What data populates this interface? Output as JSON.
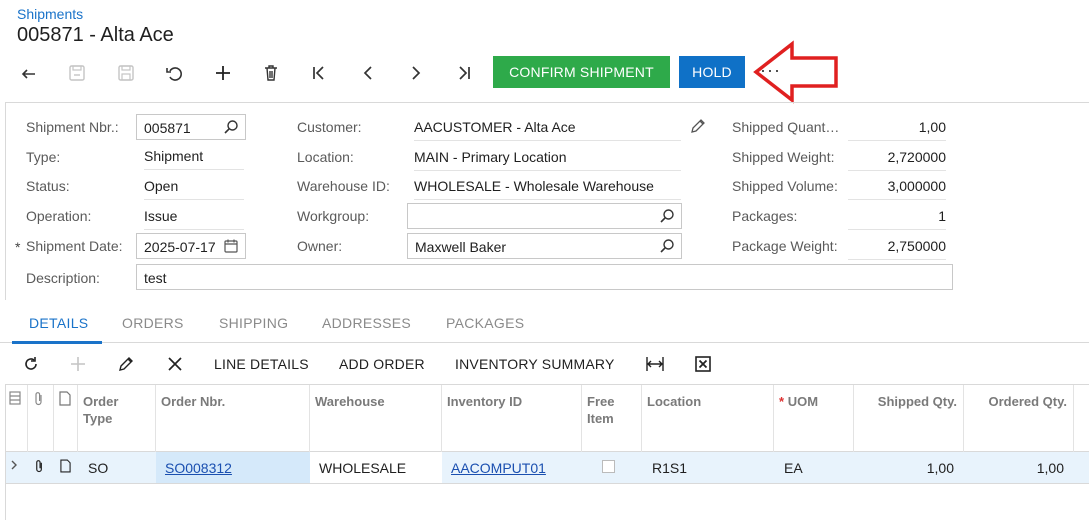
{
  "header": {
    "breadcrumb": "Shipments",
    "title": "005871 - Alta Ace"
  },
  "toolbar": {
    "icons": [
      "back-icon",
      "save-close-icon",
      "save-icon",
      "undo-icon",
      "add-icon",
      "delete-icon",
      "first-icon",
      "previous-icon",
      "next-icon",
      "last-icon"
    ],
    "confirm_label": "CONFIRM SHIPMENT",
    "hold_label": "HOLD",
    "more_label": "···"
  },
  "form": {
    "shipment_nbr": {
      "label": "Shipment Nbr.:",
      "value": "005871"
    },
    "type": {
      "label": "Type:",
      "value": "Shipment"
    },
    "status": {
      "label": "Status:",
      "value": "Open"
    },
    "operation": {
      "label": "Operation:",
      "value": "Issue"
    },
    "shipment_date": {
      "label": "Shipment Date:",
      "value": "2025-07-17",
      "required_mark": "*"
    },
    "description": {
      "label": "Description:",
      "value": "test"
    },
    "customer": {
      "label": "Customer:",
      "value": "AACUSTOMER - Alta Ace"
    },
    "location": {
      "label": "Location:",
      "value": "MAIN - Primary Location"
    },
    "warehouse_id": {
      "label": "Warehouse ID:",
      "value": "WHOLESALE - Wholesale Warehouse"
    },
    "workgroup": {
      "label": "Workgroup:",
      "value": ""
    },
    "owner": {
      "label": "Owner:",
      "value": "Maxwell Baker"
    },
    "shipped_quantity": {
      "label": "Shipped Quant…",
      "value": "1,00"
    },
    "shipped_weight": {
      "label": "Shipped Weight:",
      "value": "2,720000"
    },
    "shipped_volume": {
      "label": "Shipped Volume:",
      "value": "3,000000"
    },
    "packages": {
      "label": "Packages:",
      "value": "1"
    },
    "package_weight": {
      "label": "Package Weight:",
      "value": "2,750000"
    }
  },
  "tabs": [
    "DETAILS",
    "ORDERS",
    "SHIPPING",
    "ADDRESSES",
    "PACKAGES"
  ],
  "grid_toolbar": {
    "line_details": "LINE DETAILS",
    "add_order": "ADD ORDER",
    "inventory_summary": "INVENTORY SUMMARY"
  },
  "grid": {
    "columns": [
      "Order Type",
      "Order Nbr.",
      "Warehouse",
      "Inventory ID",
      "Free Item",
      "Location",
      "UOM",
      "Shipped Qty.",
      "Ordered Qty."
    ],
    "uom_required_mark": "*",
    "rows": [
      {
        "order_type": "SO",
        "order_nbr": "SO008312",
        "warehouse": "WHOLESALE",
        "inventory_id": "AACOMPUT01",
        "free_item": false,
        "location": "R1S1",
        "uom": "EA",
        "shipped_qty": "1,00",
        "ordered_qty": "1,00"
      }
    ]
  },
  "colors": {
    "accent": "#1a73c9",
    "confirm": "#2eaa4a",
    "hold": "#0f71c7",
    "annotation_arrow": "#e02020"
  }
}
